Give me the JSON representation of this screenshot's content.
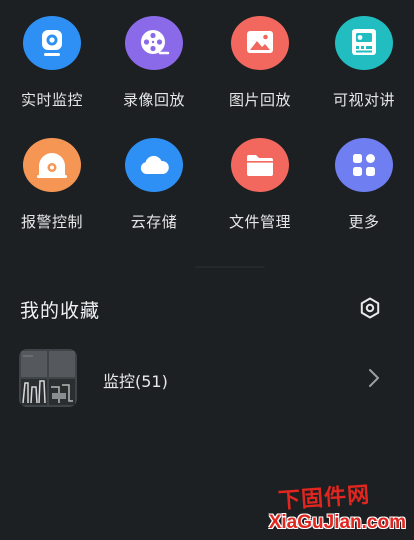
{
  "tiles": [
    {
      "label": "实时监控",
      "icon": "camera-icon",
      "color": "#2e90f4"
    },
    {
      "label": "录像回放",
      "icon": "film-reel-icon",
      "color": "#8a6ae8"
    },
    {
      "label": "图片回放",
      "icon": "picture-icon",
      "color": "#f2685e"
    },
    {
      "label": "可视对讲",
      "icon": "intercom-icon",
      "color": "#21bdc0"
    },
    {
      "label": "报警控制",
      "icon": "alarm-icon",
      "color": "#f69655"
    },
    {
      "label": "云存储",
      "icon": "cloud-icon",
      "color": "#2e90f4"
    },
    {
      "label": "文件管理",
      "icon": "folder-icon",
      "color": "#f2685e"
    },
    {
      "label": "更多",
      "icon": "more-grid-icon",
      "color": "#6f7ef0"
    }
  ],
  "favorites": {
    "title": "我的收藏",
    "settings_icon": "settings-icon",
    "items": [
      {
        "label": "监控(51)",
        "icon": "chevron-right-icon"
      }
    ]
  },
  "watermark": {
    "top": "下固件网",
    "bottom": "XiaGuJian.com"
  }
}
